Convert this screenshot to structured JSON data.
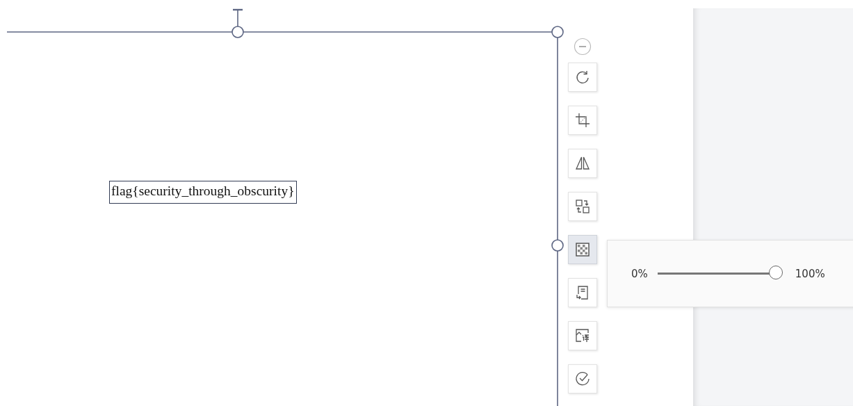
{
  "canvas": {
    "text_box": "flag{security_through_obscurity}"
  },
  "toolbar": {
    "buttons": [
      {
        "kind": "rotate",
        "selected": false
      },
      {
        "kind": "crop",
        "selected": false
      },
      {
        "kind": "flip",
        "selected": false
      },
      {
        "kind": "swap",
        "selected": false
      },
      {
        "kind": "transparency",
        "selected": true
      },
      {
        "kind": "extract",
        "selected": false
      },
      {
        "kind": "translate",
        "selected": false
      },
      {
        "kind": "check",
        "selected": false
      }
    ]
  },
  "transparency_popup": {
    "min_label": "0%",
    "max_label": "100%",
    "level": 1.0
  }
}
